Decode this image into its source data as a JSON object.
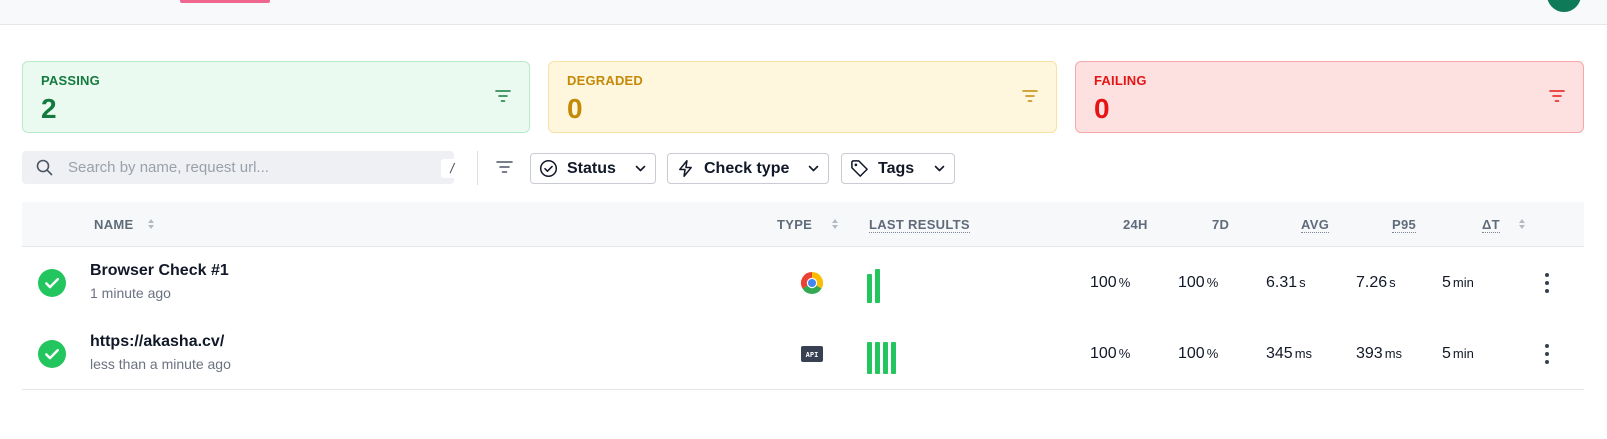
{
  "summary": {
    "passing": {
      "label": "PASSING",
      "count": "2"
    },
    "degraded": {
      "label": "DEGRADED",
      "count": "0"
    },
    "failing": {
      "label": "FAILING",
      "count": "0"
    }
  },
  "toolbar": {
    "search_placeholder": "Search by name, request url...",
    "search_shortcut": "/",
    "filters": [
      {
        "label": "Status",
        "icon": "check-circle-icon"
      },
      {
        "label": "Check type",
        "icon": "lightning-icon"
      },
      {
        "label": "Tags",
        "icon": "tag-icon"
      }
    ]
  },
  "table": {
    "headers": {
      "name": "NAME",
      "type": "TYPE",
      "last_results": "LAST RESULTS",
      "h24": "24H",
      "d7": "7D",
      "avg": "AVG",
      "p95": "P95",
      "dt": "ΔT"
    },
    "rows": [
      {
        "name": "Browser Check #1",
        "subtitle": "1 minute ago",
        "type_icon": "chrome-icon",
        "results": [
          1,
          1
        ],
        "h24": "100",
        "h24_unit": "%",
        "d7": "100",
        "d7_unit": "%",
        "avg": "6.31",
        "avg_unit": "s",
        "p95": "7.26",
        "p95_unit": "s",
        "dt": "5",
        "dt_unit": "min"
      },
      {
        "name": "https://akasha.cv/",
        "subtitle": "less than a minute ago",
        "type_icon": "api-icon",
        "type_label": "API",
        "results": [
          1,
          1,
          1,
          1
        ],
        "h24": "100",
        "h24_unit": "%",
        "d7": "100",
        "d7_unit": "%",
        "avg": "345",
        "avg_unit": "ms",
        "p95": "393",
        "p95_unit": "ms",
        "dt": "5",
        "dt_unit": "min"
      }
    ]
  },
  "colors": {
    "passing": "#157a3e",
    "degraded": "#c48a07",
    "failing": "#e51515",
    "success_bar": "#22c55e"
  }
}
